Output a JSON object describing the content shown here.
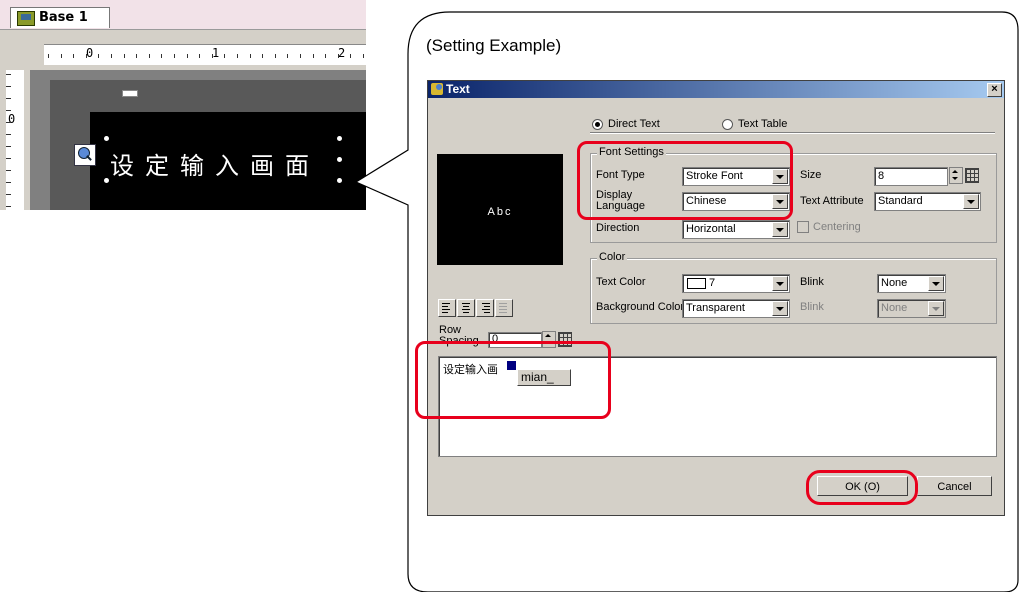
{
  "editor": {
    "tab_label": "Base 1",
    "ruler_h_marks": [
      "0",
      "1",
      "2"
    ],
    "ruler_v_mark": "0",
    "screen_text": "设定输入画面"
  },
  "callout": {
    "title": "(Setting Example)"
  },
  "dialog": {
    "title": "Text",
    "close_label": "×",
    "source_options": [
      {
        "label": "Direct Text",
        "selected": true
      },
      {
        "label": "Text Table",
        "selected": false
      }
    ],
    "preview_text": "Abc",
    "font_settings": {
      "legend": "Font Settings",
      "font_type_label": "Font Type",
      "font_type_value": "Stroke Font",
      "display_language_label": "Display Language",
      "display_language_value": "Chinese",
      "direction_label": "Direction",
      "direction_value": "Horizontal",
      "size_label": "Size",
      "size_value": "8",
      "text_attribute_label": "Text Attribute",
      "text_attribute_value": "Standard",
      "centering_label": "Centering"
    },
    "color": {
      "legend": "Color",
      "text_color_label": "Text Color",
      "text_color_value": "7",
      "background_color_label": "Background Color",
      "background_color_value": "Transparent",
      "blink_label": "Blink",
      "blink_value": "None",
      "blink2_label": "Blink",
      "blink2_value": "None"
    },
    "row_spacing_label": "Row Spacing",
    "row_spacing_value": "0",
    "text_content": "设定输入画",
    "ime_candidate": "mian_",
    "ok_label": "OK (O)",
    "cancel_label": "Cancel"
  },
  "colors": {
    "highlight": "#e8001c",
    "titlebar_start": "#0a246a",
    "titlebar_end": "#a6caf0",
    "dialog_face": "#d4d0c8"
  }
}
